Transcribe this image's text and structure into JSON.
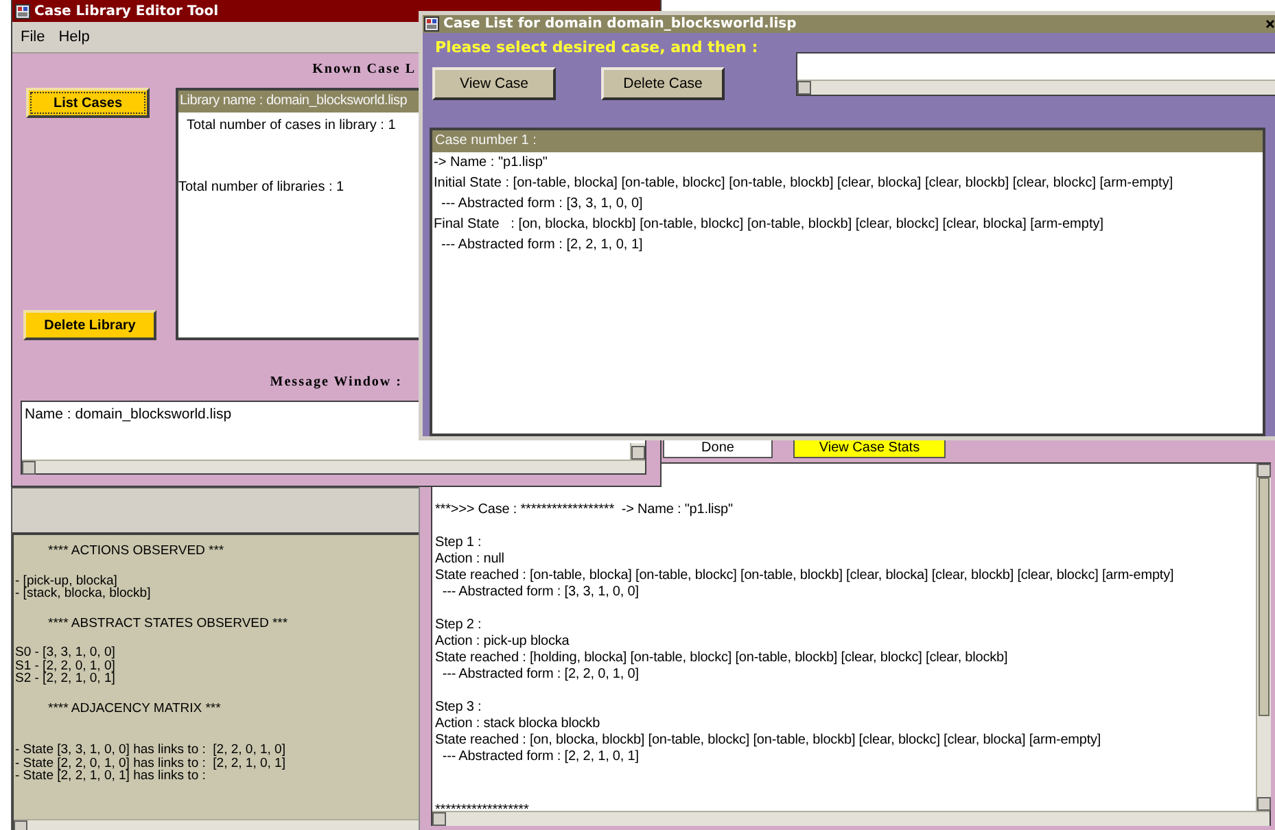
{
  "stats_panel": {
    "blocks": [
      {
        "kind": "heading",
        "lines": [
          "**** ACTIONS OBSERVED ***"
        ]
      },
      {
        "kind": "list",
        "lines": [
          "- [pick-up, blocka]",
          "- [stack, blocka, blockb]"
        ]
      },
      {
        "kind": "heading",
        "lines": [
          "**** ABSTRACT STATES OBSERVED ***"
        ]
      },
      {
        "kind": "list",
        "lines": [
          "S0 - [3, 3, 1, 0, 0]",
          "S1 - [2, 2, 0, 1, 0]",
          "S2 - [2, 2, 1, 0, 1]"
        ]
      },
      {
        "kind": "heading",
        "lines": [
          "**** ADJACENCY MATRIX ***"
        ]
      },
      {
        "kind": "matrix",
        "lines": [
          "- State [3, 3, 1, 0, 0] has links to :  [2, 2, 0, 1, 0]",
          "- State [2, 2, 0, 1, 0] has links to :  [2, 2, 1, 0, 1]",
          "- State [2, 2, 1, 0, 1] has links to :"
        ]
      }
    ]
  },
  "case_view_window": {
    "buttons": [
      {
        "label": "Done",
        "kind": "plain"
      },
      {
        "label": "View Case Stats",
        "kind": "highlight"
      }
    ],
    "blocks": [
      {
        "kind": "header",
        "lines": [
          "***>>> Case : ******************  -> Name : \"p1.lisp\""
        ]
      },
      {
        "kind": "step",
        "lines": [
          "Step 1 :",
          "Action : null",
          "State reached : [on-table, blocka] [on-table, blockc] [on-table, blockb] [clear, blocka] [clear, blockb] [clear, blockc] [arm-empty]",
          "  --- Abstracted form : [3, 3, 1, 0, 0]"
        ]
      },
      {
        "kind": "step",
        "lines": [
          "Step 2 :",
          "Action : pick-up blocka",
          "State reached : [holding, blocka] [on-table, blockc] [on-table, blockb] [clear, blockc] [clear, blockb]",
          "  --- Abstracted form : [2, 2, 0, 1, 0]"
        ]
      },
      {
        "kind": "step",
        "lines": [
          "Step 3 :",
          "Action : stack blocka blockb",
          "State reached : [on, blocka, blockb] [on-table, blockc] [on-table, blockb] [clear, blockc] [clear, blocka] [arm-empty]",
          "  --- Abstracted form : [2, 2, 1, 0, 1]"
        ]
      },
      {
        "kind": "footer",
        "lines": [
          "******************"
        ]
      }
    ]
  },
  "library_window": {
    "title": "Case Library Editor Tool",
    "menu": [
      {
        "label": "File"
      },
      {
        "label": "Help"
      }
    ],
    "known_label": "Known Case L",
    "buttons": [
      {
        "label": "List Cases",
        "focused": true
      },
      {
        "label": "Delete Library",
        "focused": false
      }
    ],
    "library_list": {
      "header": "Library name : domain_blocksworld.lisp",
      "items": [
        {
          "text": "Total number of cases in library : 1",
          "kind": "detail"
        },
        {
          "text": "Total number of libraries : 1",
          "kind": "total"
        }
      ]
    },
    "message_label": "Message Window :",
    "message_text": "Name : domain_blocksworld.lisp"
  },
  "case_list_window": {
    "title": "Case List for domain domain_blocksworld.lisp",
    "prompt": "Please select desired case, and then :",
    "buttons": [
      {
        "label": "View Case"
      },
      {
        "label": "Delete Case"
      }
    ],
    "case_list": {
      "header": "Case number 1 :",
      "lines": [
        "-> Name : \"p1.lisp\"",
        "Initial State : [on-table, blocka] [on-table, blockc] [on-table, blockb] [clear, blocka] [clear, blockb] [clear, blockc] [arm-empty]",
        "  --- Abstracted form : [3, 3, 1, 0, 0]",
        "Final State   : [on, blocka, blockb] [on-table, blockc] [on-table, blockb] [clear, blockc] [clear, blocka] [arm-empty]",
        "  --- Abstracted form : [2, 2, 1, 0, 1]"
      ]
    }
  }
}
